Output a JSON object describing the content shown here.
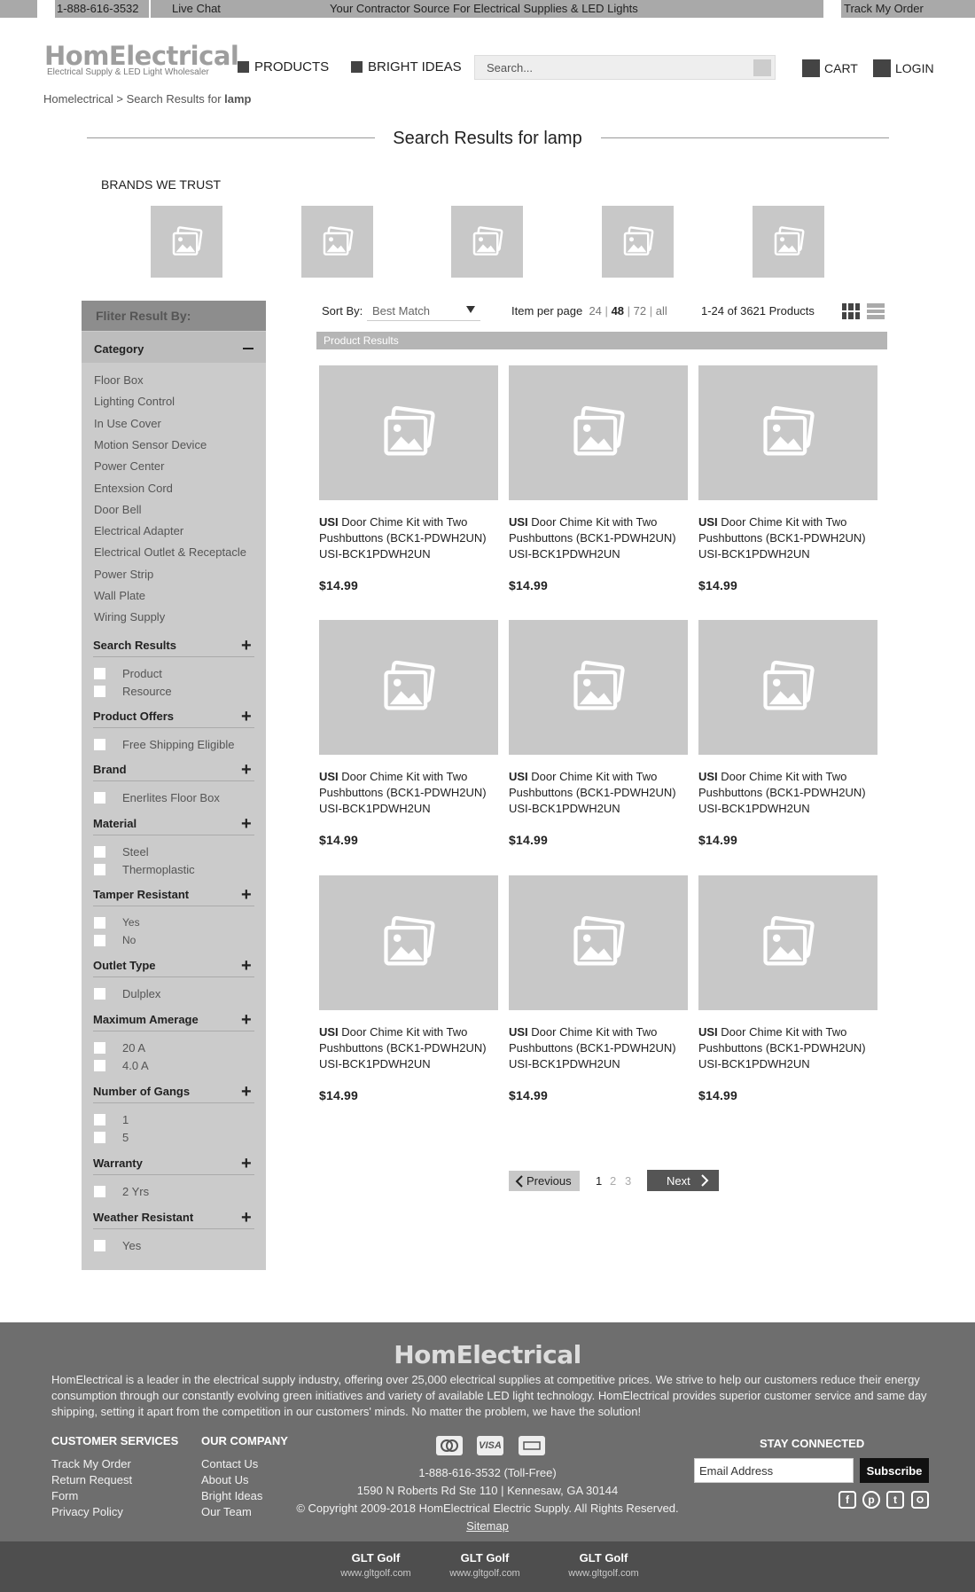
{
  "topbar": {
    "phone": "1-888-616-3532",
    "live_chat": "Live Chat",
    "tagline": "Your Contractor Source For Electrical Supplies & LED Lights",
    "track_order": "Track My Order"
  },
  "header": {
    "logo": "HomElectrical",
    "logo_sub": "Electrical Supply & LED Light Wholesaler",
    "nav": [
      "PRODUCTS",
      "BRIGHT IDEAS"
    ],
    "search_placeholder": "Search...",
    "cart": "CART",
    "login": "LOGIN"
  },
  "breadcrumb": {
    "home": "Homelectrical",
    "sep": ">",
    "current_prefix": "Search Results for",
    "query": "lamp"
  },
  "page_title": "Search Results for lamp",
  "brands": {
    "heading": "BRANDS WE TRUST",
    "count": 5
  },
  "sidebar": {
    "heading": "Fliter Result By:",
    "category_label": "Category",
    "categories": [
      "Floor Box",
      "Lighting Control",
      "In Use Cover",
      "Motion Sensor Device",
      "Power Center",
      "Entexsion Cord",
      "Door Bell",
      "Electrical Adapter",
      "Electrical Outlet & Receptacle",
      "Power Strip",
      "Wall Plate",
      "Wiring Supply"
    ],
    "sections": [
      {
        "title": "Search Results",
        "options": [
          "Product",
          "Resource"
        ]
      },
      {
        "title": "Product Offers",
        "options": [
          "Free Shipping Eligible"
        ]
      },
      {
        "title": "Brand",
        "options": [
          "Enerlites Floor Box"
        ]
      },
      {
        "title": "Material",
        "options": [
          "Steel",
          "Thermoplastic"
        ]
      },
      {
        "title": "Tamper Resistant",
        "options": [
          "Yes",
          "No"
        ]
      },
      {
        "title": "Outlet Type",
        "options": [
          "Dulplex"
        ]
      },
      {
        "title": "Maximum Amerage",
        "options": [
          "20 A",
          "4.0 A"
        ]
      },
      {
        "title": "Number of Gangs",
        "options": [
          "1",
          "5"
        ]
      },
      {
        "title": "Warranty",
        "options": [
          "2 Yrs"
        ]
      },
      {
        "title": "Weather Resistant",
        "options": [
          "Yes"
        ]
      }
    ]
  },
  "toolbar": {
    "sort_label": "Sort By:",
    "sort_value": "Best Match",
    "ipp_label": "Item per page",
    "ipp_options": [
      "24",
      "48",
      "72",
      "all"
    ],
    "ipp_selected": "48",
    "result_count": "1-24 of 3621 Products"
  },
  "results_bar": "Product Results",
  "products": [
    {
      "brand": "USI",
      "name": "Door Chime Kit with Two Pushbuttons (BCK1-PDWH2UN)",
      "sku": "USI-BCK1PDWH2UN",
      "price": "$14.99"
    },
    {
      "brand": "USI",
      "name": "Door Chime Kit with Two Pushbuttons (BCK1-PDWH2UN)",
      "sku": "USI-BCK1PDWH2UN",
      "price": "$14.99"
    },
    {
      "brand": "USI",
      "name": "Door Chime Kit with Two Pushbuttons (BCK1-PDWH2UN)",
      "sku": "USI-BCK1PDWH2UN",
      "price": "$14.99"
    },
    {
      "brand": "USI",
      "name": "Door Chime Kit with Two Pushbuttons (BCK1-PDWH2UN)",
      "sku": "USI-BCK1PDWH2UN",
      "price": "$14.99"
    },
    {
      "brand": "USI",
      "name": "Door Chime Kit with Two Pushbuttons (BCK1-PDWH2UN)",
      "sku": "USI-BCK1PDWH2UN",
      "price": "$14.99"
    },
    {
      "brand": "USI",
      "name": "Door Chime Kit with Two Pushbuttons (BCK1-PDWH2UN)",
      "sku": "USI-BCK1PDWH2UN",
      "price": "$14.99"
    },
    {
      "brand": "USI",
      "name": "Door Chime Kit with Two Pushbuttons (BCK1-PDWH2UN)",
      "sku": "USI-BCK1PDWH2UN",
      "price": "$14.99"
    },
    {
      "brand": "USI",
      "name": "Door Chime Kit with Two Pushbuttons (BCK1-PDWH2UN)",
      "sku": "USI-BCK1PDWH2UN",
      "price": "$14.99"
    },
    {
      "brand": "USI",
      "name": "Door Chime Kit with Two Pushbuttons (BCK1-PDWH2UN)",
      "sku": "USI-BCK1PDWH2UN",
      "price": "$14.99"
    }
  ],
  "pagination": {
    "prev": "Previous",
    "pages": [
      "1",
      "2",
      "3"
    ],
    "current": "1",
    "next": "Next"
  },
  "footer": {
    "logo": "HomElectrical",
    "description": "HomElectrical is a leader in the electrical supply industry, offering over 25,000 electrical supplies at competitive prices. We strive to help our customers reduce their energy consumption through our constantly evolving green initiatives and variety of available LED light technology. HomElectrical provides superior customer service and same day shipping, setting it apart from the competition in our customers' minds. No matter the problem, we have the solution!",
    "customer_services": {
      "title": "CUSTOMER SERVICES",
      "links": [
        "Track My Order",
        "Return Request",
        "Form",
        "Privacy Policy"
      ]
    },
    "our_company": {
      "title": "OUR COMPANY",
      "links": [
        "Contact Us",
        "About Us",
        "Bright Ideas",
        "Our Team"
      ]
    },
    "payment_cards": [
      "mastercard-icon",
      "visa-icon",
      "amex-icon"
    ],
    "card_labels": {
      "visa": "VISA"
    },
    "phone": "1-888-616-3532 (Toll-Free)",
    "address": "1590 N Roberts Rd Ste 110 | Kennesaw, GA 30144",
    "copyright": "© Copyright 2009-2018 HomElectrical Electric Supply. All Rights Reserved.",
    "sitemap": "Sitemap",
    "stay_connected": "STAY CONNECTED",
    "email_placeholder": "Email Address",
    "subscribe": "Subscribe",
    "social": [
      "facebook-icon",
      "pinterest-icon",
      "twitter-icon",
      "instagram-icon"
    ]
  },
  "subfooter": [
    {
      "name": "GLT Golf",
      "url": "www.gltgolf.com"
    },
    {
      "name": "GLT Golf",
      "url": "www.gltgolf.com"
    },
    {
      "name": "GLT Golf",
      "url": "www.gltgolf.com"
    }
  ],
  "colors": {
    "footer_bg": "#6e6e6e",
    "subfooter_bg": "#4e4e4e",
    "sidebar_bg": "#cbcbcb",
    "next_btn": "#555555"
  }
}
